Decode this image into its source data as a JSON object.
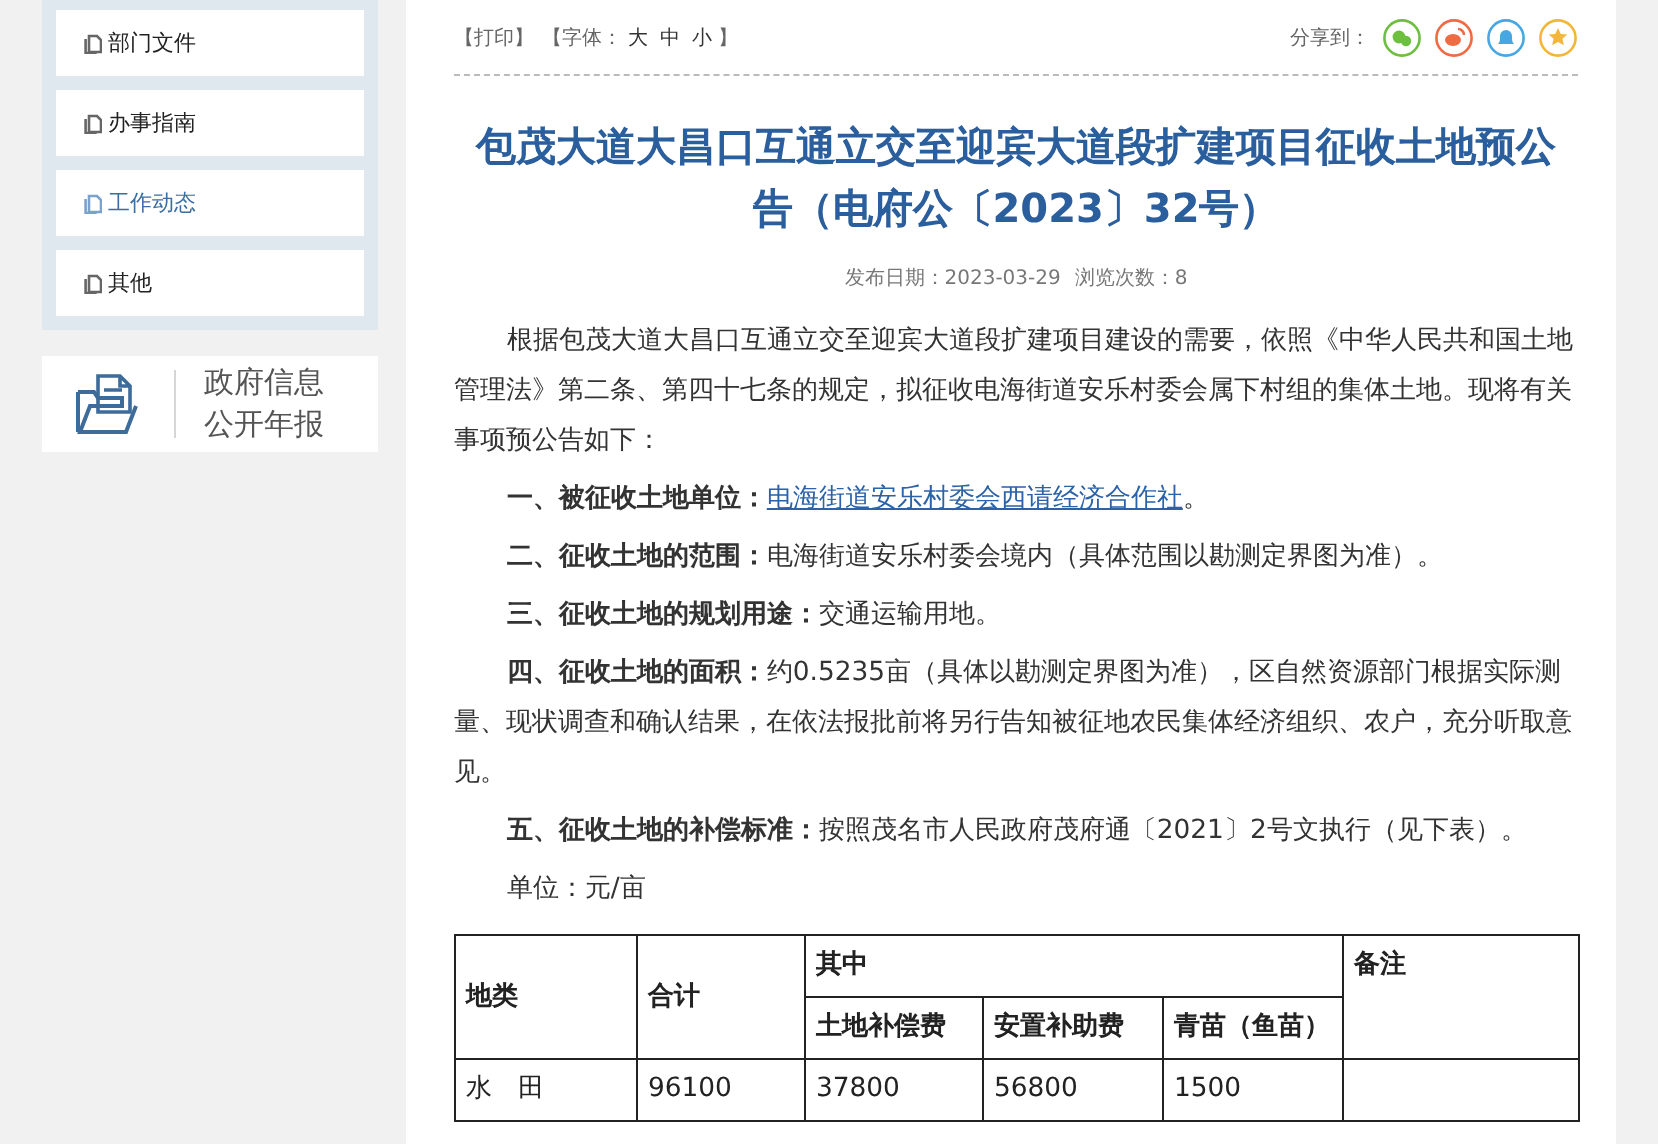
{
  "sidebar": {
    "items": [
      {
        "label": "部门文件",
        "selected": false
      },
      {
        "label": "办事指南",
        "selected": false
      },
      {
        "label": "工作动态",
        "selected": true
      },
      {
        "label": "其他",
        "selected": false
      }
    ]
  },
  "annual_report": {
    "lines": [
      "政府信息",
      "公开年报"
    ]
  },
  "toolbar": {
    "print": "【打印】",
    "font_label": "【字体：",
    "font_sizes": [
      "大",
      "中",
      "小"
    ],
    "font_close": "】",
    "share_label": "分享到："
  },
  "article": {
    "title": "包茂大道大昌口互通立交至迎宾大道段扩建项目征收土地预公告（电府公〔2023〕32号）",
    "date": "发布日期：2023-03-29",
    "views": "浏览次数：8",
    "paragraphs": [
      {
        "kind": "plain",
        "text": "根据包茂大道大昌口互通立交至迎宾大道段扩建项目建设的需要，依照《中华人民共和国土地管理法》第二条、第四十七条的规定，拟征收电海街道安乐村委会属下村组的集体土地。现将有关事项预公告如下："
      },
      {
        "kind": "link",
        "text": "**一、被征收土地单位：**",
        "link": "电海街道安乐村委会西请经济合作社",
        "tail": "。"
      },
      {
        "kind": "plain",
        "text": "**二、征收土地的范围：**电海街道安乐村委会境内（具体范围以勘测定界图为准）。"
      },
      {
        "kind": "plain",
        "text": "**三、征收土地的规划用途：**交通运输用地。"
      },
      {
        "kind": "plain",
        "text": "**四、征收土地的面积：**约0.5235亩（具体以勘测定界图为准），区自然资源部门根据实际测量、现状调查和确认结果，在依法报批前将另行告知被征地农民集体经济组织、农户，充分听取意见。"
      },
      {
        "kind": "plain",
        "text": "**五、征收土地的补偿标准：**按照茂名市人民政府茂府通〔2021〕2号文执行（见下表）。"
      },
      {
        "kind": "plain",
        "text": "单位：元/亩"
      }
    ],
    "table": {
      "land_type": "地类",
      "total": "合计",
      "group": "其中",
      "sub": [
        "土地补偿费",
        "安置补助费",
        "青苗（鱼苗）"
      ],
      "remark": "备注",
      "rows": [
        [
          "水　田",
          "96100",
          "37800",
          "56800",
          "1500"
        ]
      ]
    }
  }
}
